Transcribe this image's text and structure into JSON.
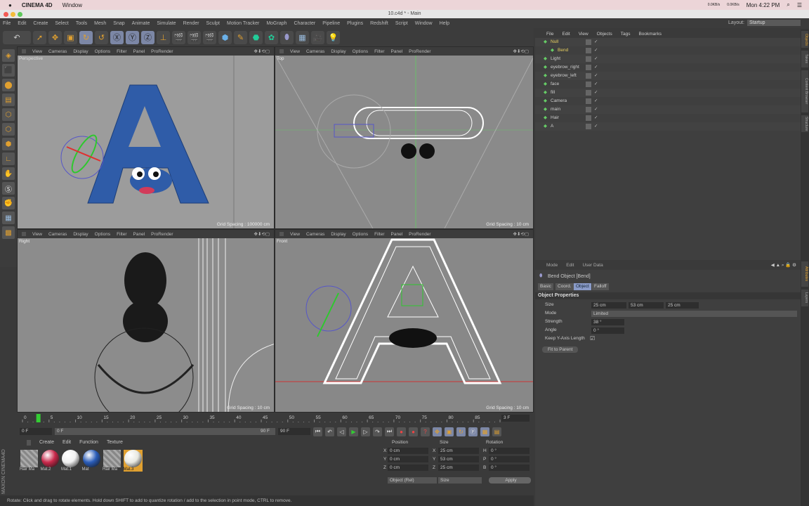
{
  "mac": {
    "app": "CINEMA 4D",
    "menu": "Window",
    "net_up": "0.0KB/s",
    "net_down": "0.0KB/s",
    "clock": "Mon 4:22 PM"
  },
  "window": {
    "title": "10.c4d * - Main"
  },
  "menu": [
    "File",
    "Edit",
    "Create",
    "Select",
    "Tools",
    "Mesh",
    "Snap",
    "Animate",
    "Simulate",
    "Render",
    "Sculpt",
    "Motion Tracker",
    "MoGraph",
    "Character",
    "Pipeline",
    "Plugins",
    "Redshift",
    "Script",
    "Window",
    "Help"
  ],
  "layout": {
    "label": "Layout:",
    "value": "Startup"
  },
  "viewport_menu": [
    "View",
    "Cameras",
    "Display",
    "Options",
    "Filter",
    "Panel",
    "ProRender"
  ],
  "viewports": [
    {
      "name": "Perspective",
      "grid": "Grid Spacing : 100000 cm"
    },
    {
      "name": "Top",
      "grid": "Grid Spacing : 10 cm"
    },
    {
      "name": "Right",
      "grid": "Grid Spacing : 10 cm"
    },
    {
      "name": "Front",
      "grid": "Grid Spacing : 10 cm"
    }
  ],
  "timeline": {
    "ticks": [
      0,
      5,
      10,
      15,
      20,
      25,
      30,
      35,
      40,
      45,
      50,
      55,
      60,
      65,
      70,
      75,
      80,
      85,
      90
    ],
    "current_marker": "3",
    "current_frame": "3 F",
    "start": "0 F",
    "range_start": "0 F",
    "range_end": "90 F",
    "end": "90 F"
  },
  "materials": {
    "menu": [
      "Create",
      "Edit",
      "Function",
      "Texture"
    ],
    "items": [
      {
        "name": "Hair Ma",
        "color": "hatched"
      },
      {
        "name": "Mat.2",
        "color": "#c8284a"
      },
      {
        "name": "Mat.1",
        "color": "#f0f0f0"
      },
      {
        "name": "Mat",
        "color": "#2a5cb8"
      },
      {
        "name": "Hair Ma",
        "color": "hatched"
      },
      {
        "name": "Mat.3",
        "color": "#e8e8e0",
        "selected": true
      }
    ]
  },
  "coords": {
    "headers": [
      "Position",
      "Size",
      "Rotation"
    ],
    "rows": [
      {
        "a": "X",
        "pos": "0 cm",
        "b": "X",
        "size": "25 cm",
        "c": "H",
        "rot": "0 °"
      },
      {
        "a": "Y",
        "pos": "0 cm",
        "b": "Y",
        "size": "53 cm",
        "c": "P",
        "rot": "0 °"
      },
      {
        "a": "Z",
        "pos": "0 cm",
        "b": "Z",
        "size": "25 cm",
        "c": "B",
        "rot": "0 °"
      }
    ],
    "mode": "Object (Rel)",
    "size_mode": "Size",
    "apply": "Apply"
  },
  "status": "Rotate: Click and drag to rotate elements. Hold down SHIFT to add to quantize rotation / add to the selection in point mode, CTRL to remove.",
  "objects": {
    "menu": [
      "File",
      "Edit",
      "View",
      "Objects",
      "Tags",
      "Bookmarks"
    ],
    "items": [
      {
        "name": "Null",
        "indent": 0
      },
      {
        "name": "Bend",
        "indent": 1
      },
      {
        "name": "Light",
        "indent": 0
      },
      {
        "name": "eyebrow_right",
        "indent": 0
      },
      {
        "name": "eyebrow_left",
        "indent": 0
      },
      {
        "name": "face",
        "indent": 0
      },
      {
        "name": "fill",
        "indent": 0
      },
      {
        "name": "Camera",
        "indent": 0
      },
      {
        "name": "main",
        "indent": 0
      },
      {
        "name": "Hair",
        "indent": 0
      },
      {
        "name": "A",
        "indent": 0
      }
    ]
  },
  "attributes": {
    "menu": [
      "Mode",
      "Edit",
      "User Data"
    ],
    "title": "Bend Object [Bend]",
    "tabs": [
      "Basic",
      "Coord.",
      "Object",
      "Falloff"
    ],
    "active_tab": "Object",
    "section": "Object Properties",
    "size_label": "Size",
    "size": [
      "25 cm",
      "53 cm",
      "25 cm"
    ],
    "mode_label": "Mode",
    "mode": "Limited",
    "strength_label": "Strength",
    "strength": "38 °",
    "angle_label": "Angle",
    "angle": "0 °",
    "keep_label": "Keep Y-Axis Length",
    "keep": true,
    "fit": "Fit to Parent"
  },
  "right_tabs": [
    "Objects",
    "Takes",
    "Content Browser",
    "Structure",
    "Attributes",
    "Layers"
  ],
  "brand": "MAXON CINEMA 4D",
  "colors": {
    "accent": "#e0a030",
    "selection": "#8a9bc8",
    "letter_blue": "#2f5ca8"
  }
}
